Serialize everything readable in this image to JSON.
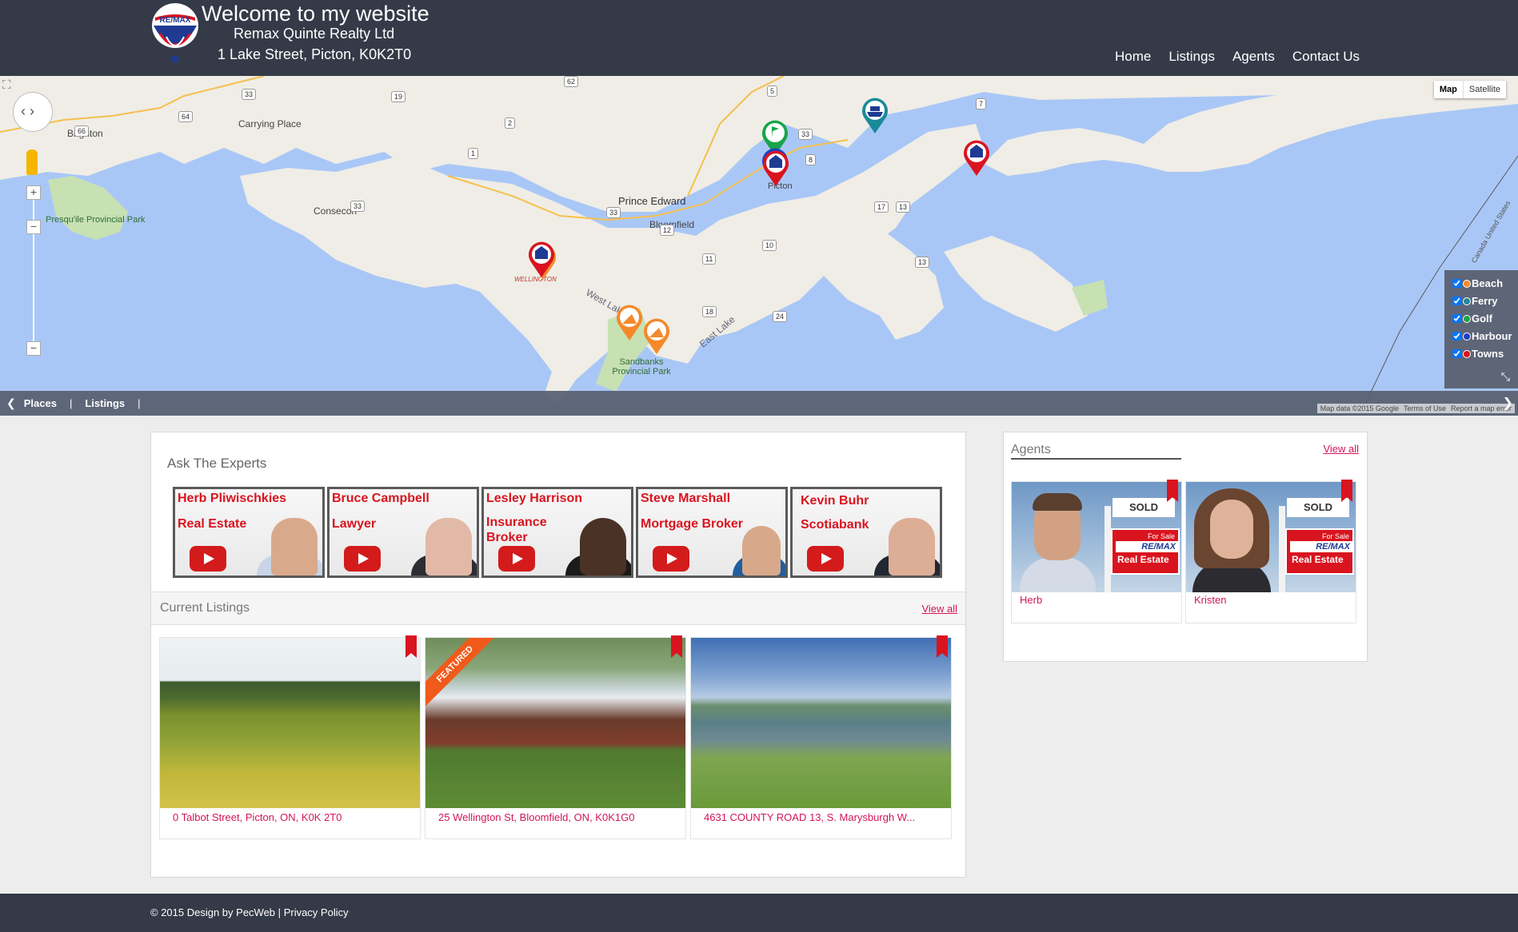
{
  "header": {
    "logo_text": "RE/MAX",
    "title": "Welcome to my website",
    "company": "Remax Quinte Realty Ltd",
    "address": "1 Lake Street, Picton, K0K2T0",
    "nav": [
      "Home",
      "Listings",
      "Agents",
      "Contact Us"
    ]
  },
  "map": {
    "type_buttons": [
      "Map",
      "Satellite"
    ],
    "labels": {
      "brighton": "Brighton",
      "carrying_place": "Carrying Place",
      "presquile": "Presqu'ile Provincial Park",
      "consecon": "Consecon",
      "prince_edward": "Prince Edward",
      "bloomfield": "Bloomfield",
      "picton": "Picton",
      "wellington": "WELLINGTON",
      "west_lake": "West Lake",
      "east_lake": "East Lake",
      "sandbanks": "Sandbanks Provincial Park",
      "usa": "Canada United States"
    },
    "shields": [
      "33",
      "64",
      "66",
      "19",
      "62",
      "2",
      "1",
      "5",
      "33",
      "8",
      "7",
      "33",
      "33",
      "12",
      "17",
      "13",
      "10",
      "11",
      "13",
      "18",
      "24"
    ],
    "legend": [
      "Beach",
      "Ferry",
      "Golf",
      "Harbour",
      "Towns"
    ],
    "bottom_bar": [
      "Places",
      "Listings"
    ],
    "attribution": [
      "Map data ©2015 Google",
      "Terms of Use",
      "Report a map error"
    ],
    "colors": {
      "water": "#a9c7f6",
      "land": "#efede6",
      "park": "#c7e1b3"
    }
  },
  "experts": {
    "title": "Ask The Experts",
    "cards": [
      {
        "name": "Herb Pliwischkies",
        "role": "Real Estate"
      },
      {
        "name": "Bruce Campbell",
        "role": "Lawyer"
      },
      {
        "name": "Lesley Harrison",
        "role": "Insurance Broker"
      },
      {
        "name": "Steve Marshall",
        "role": "Mortgage Broker"
      },
      {
        "name": "Kevin Buhr",
        "role": "Scotiabank"
      }
    ]
  },
  "listings": {
    "title": "Current Listings",
    "view_all": "View all",
    "featured_label": "FEATURED",
    "items": [
      {
        "address": "0 Talbot Street, Picton, ON, K0K 2T0"
      },
      {
        "address": "25 Wellington St, Bloomfield, ON, K0K1G0"
      },
      {
        "address": "4631 COUNTY ROAD 13, S. Marysburgh W..."
      }
    ]
  },
  "agents": {
    "title": "Agents",
    "view_all": "View all",
    "sign_sold": "SOLD",
    "sign_for_sale": "For Sale",
    "sign_brand": "RE/MAX",
    "sign_real_estate": "Real Estate",
    "items": [
      {
        "name": "Herb"
      },
      {
        "name": "Kristen"
      }
    ]
  },
  "footer": {
    "copyright": "© 2015 Design by PecWeb",
    "separator": "|",
    "privacy": "Privacy Policy"
  }
}
